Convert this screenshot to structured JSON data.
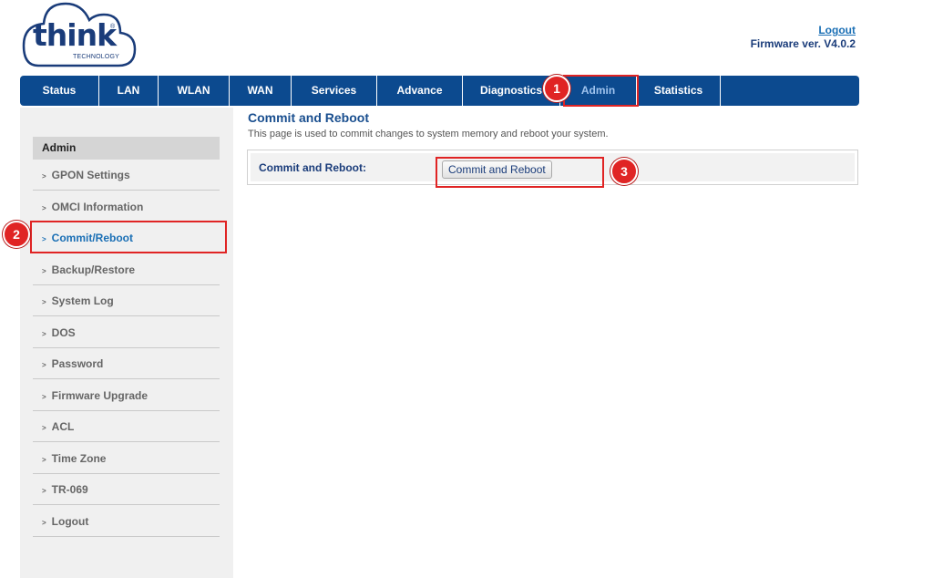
{
  "logo": {
    "word": "think",
    "registered": "®",
    "tagline": "TECHNOLOGY"
  },
  "header": {
    "logout": "Logout",
    "firmware": "Firmware ver. V4.0.2"
  },
  "nav": [
    {
      "label": "Status"
    },
    {
      "label": "LAN"
    },
    {
      "label": "WLAN"
    },
    {
      "label": "WAN"
    },
    {
      "label": "Services"
    },
    {
      "label": "Advance"
    },
    {
      "label": "Diagnostics"
    },
    {
      "label": "Admin",
      "active": true
    },
    {
      "label": "Statistics"
    }
  ],
  "sidebar": {
    "heading": "Admin",
    "items": [
      {
        "label": "GPON Settings"
      },
      {
        "label": "OMCI Information"
      },
      {
        "label": "Commit/Reboot",
        "active": true
      },
      {
        "label": "Backup/Restore"
      },
      {
        "label": "System Log"
      },
      {
        "label": "DOS"
      },
      {
        "label": "Password"
      },
      {
        "label": "Firmware Upgrade"
      },
      {
        "label": "ACL"
      },
      {
        "label": "Time Zone"
      },
      {
        "label": "TR-069"
      },
      {
        "label": "Logout"
      }
    ]
  },
  "main": {
    "title": "Commit and Reboot",
    "description": "This page is used to commit changes to system memory and reboot your system.",
    "field_label": "Commit and Reboot:",
    "button_label": "Commit and Reboot"
  },
  "annotations": {
    "step1": "1",
    "step2": "2",
    "step3": "3",
    "color": "#e02424"
  },
  "colors": {
    "nav_bg": "#0c4a8f",
    "sidebar_bg": "#f0f0f0",
    "accent": "#1a6fb5"
  }
}
